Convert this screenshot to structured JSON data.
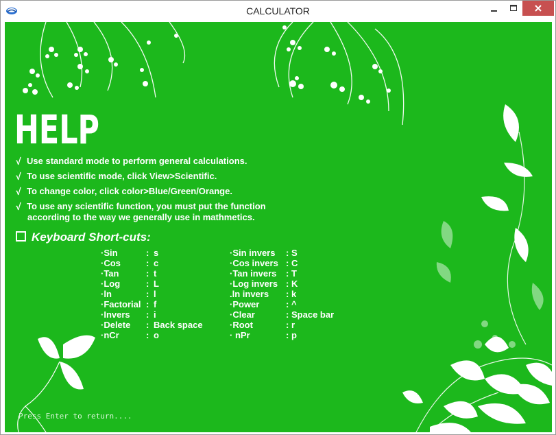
{
  "window": {
    "title": "CALCULATOR",
    "bg_color": "#1cb81c",
    "icons": {
      "app": "app-icon",
      "minimize": "minimize-icon",
      "maximize": "maximize-icon",
      "close": "close-icon"
    }
  },
  "help": {
    "heading": "HELP",
    "tips": [
      "Use standard mode to perform general calculations.",
      "To use scientific mode, click View>Scientific.",
      "To change color, click color>Blue/Green/Orange.",
      "To use any scientific function, you must put the function"
    ],
    "tip_continuation": "according to the way we generally use in mathmetics.",
    "check_mark": "√",
    "shortcuts_title": "Keyboard Short-cuts:",
    "left_keys": [
      {
        "name": "·Sin",
        "sep": ":",
        "key": "s"
      },
      {
        "name": "·Cos",
        "sep": ":",
        "key": "c"
      },
      {
        "name": "·Tan",
        "sep": ":",
        "key": "t"
      },
      {
        "name": "·Log",
        "sep": ":",
        "key": "L"
      },
      {
        "name": "·ln",
        "sep": ":",
        "key": "l"
      },
      {
        "name": "·Factorial",
        "sep": ":",
        "key": "f"
      },
      {
        "name": "·Invers",
        "sep": ":",
        "key": "i"
      },
      {
        "name": "·Delete",
        "sep": ":",
        "key": "Back space"
      },
      {
        "name": "·nCr",
        "sep": ":",
        "key": "o"
      }
    ],
    "right_keys": [
      {
        "name": "·Sin invers",
        "sep": ":",
        "key": "S"
      },
      {
        "name": "·Cos invers",
        "sep": ":",
        "key": "C"
      },
      {
        "name": "·Tan invers",
        "sep": ":",
        "key": "T"
      },
      {
        "name": "·Log invers",
        "sep": ":",
        "key": "K"
      },
      {
        "name": ".ln invers",
        "sep": ":",
        "key": "k"
      },
      {
        "name": "·Power",
        "sep": ":",
        "key": "^"
      },
      {
        "name": "·Clear",
        "sep": ":",
        "key": "Space bar"
      },
      {
        "name": "·Root",
        "sep": ":",
        "key": "r"
      },
      {
        "name": "· nPr",
        "sep": ":",
        "key": "p"
      }
    ],
    "prompt": "Press Enter to return...."
  }
}
